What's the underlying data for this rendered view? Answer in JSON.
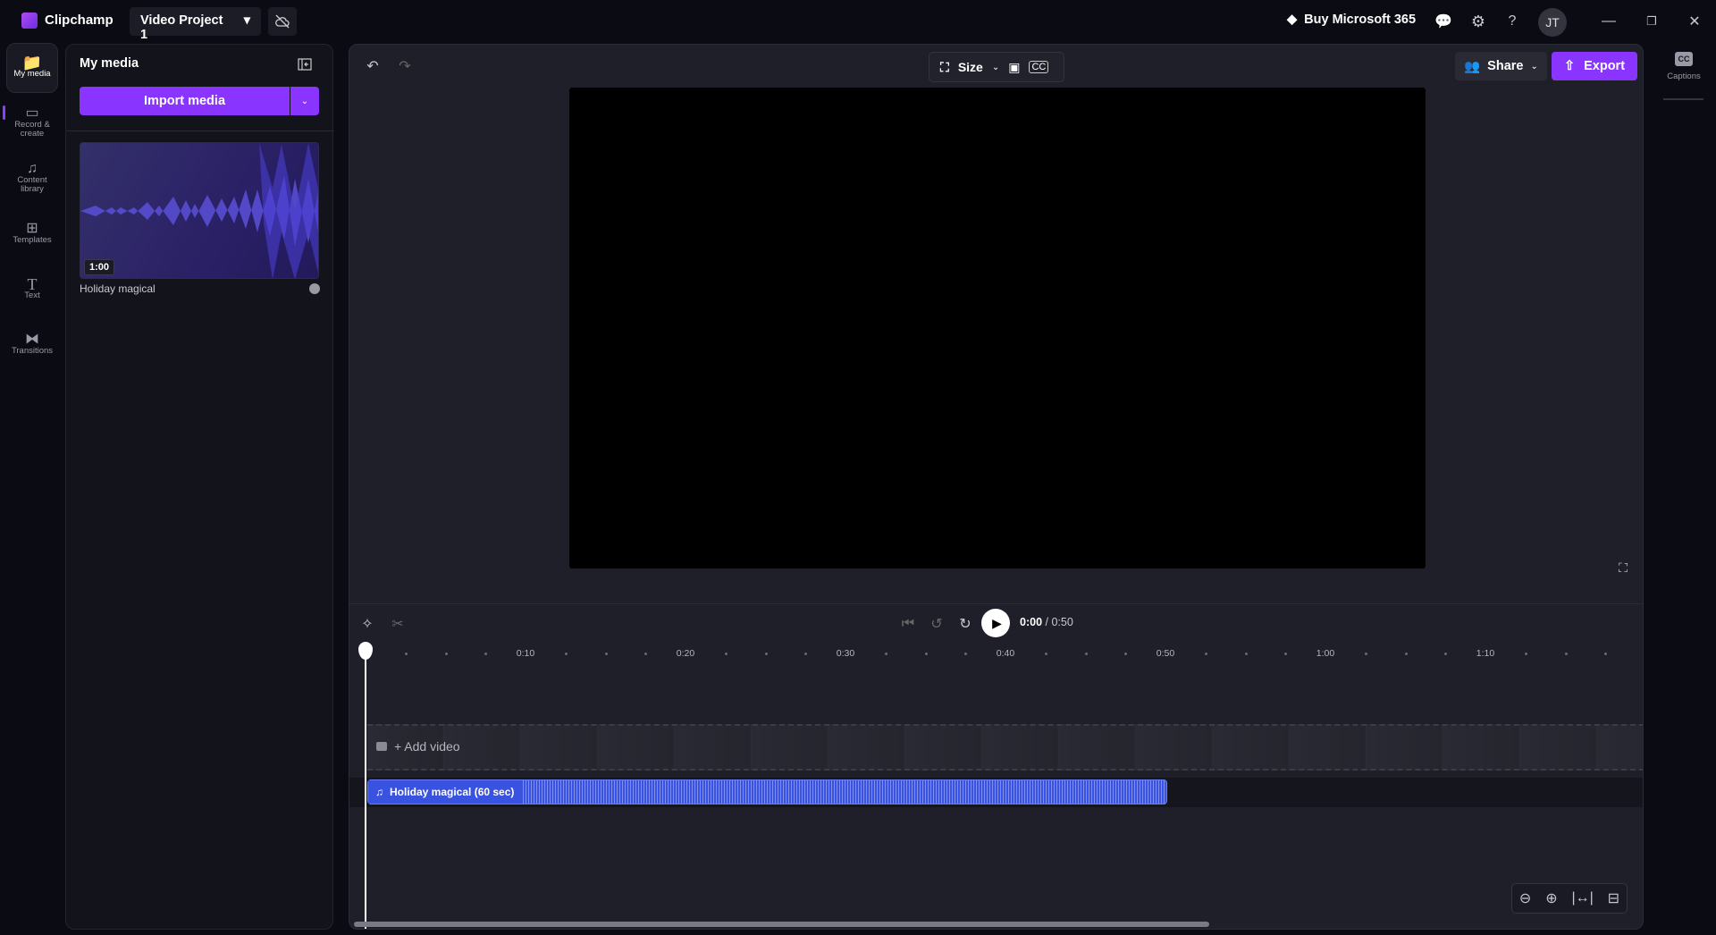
{
  "app": {
    "name": "Clipchamp",
    "project": "Video Project 1",
    "buy_label": "Buy Microsoft 365",
    "avatar_initials": "JT"
  },
  "rail": [
    {
      "label": "My media"
    },
    {
      "label": "Record & create"
    },
    {
      "label": "Content library"
    },
    {
      "label": "Templates"
    },
    {
      "label": "Text"
    },
    {
      "label": "Transitions"
    }
  ],
  "media_panel": {
    "title": "My media",
    "import_label": "Import media",
    "items": [
      {
        "name": "Holiday magical",
        "duration": "1:00"
      }
    ]
  },
  "toolbar": {
    "size_label": "Size",
    "share_label": "Share",
    "export_label": "Export"
  },
  "right_panel": {
    "captions_label": "Captions",
    "cc": "CC"
  },
  "playback": {
    "current": "0:00",
    "total": "/ 0:50"
  },
  "timeline": {
    "ticks": [
      "0:10",
      "0:20",
      "0:30",
      "0:40",
      "0:50",
      "1:00",
      "1:10"
    ],
    "add_video_label": "+ Add video",
    "audio_clip_label": "Holiday magical (60 sec)",
    "playhead_seconds": 0,
    "audio_clip_end_seconds": 50
  },
  "colors": {
    "accent": "#8a34ff",
    "audio_clip": "#3a52e0"
  }
}
